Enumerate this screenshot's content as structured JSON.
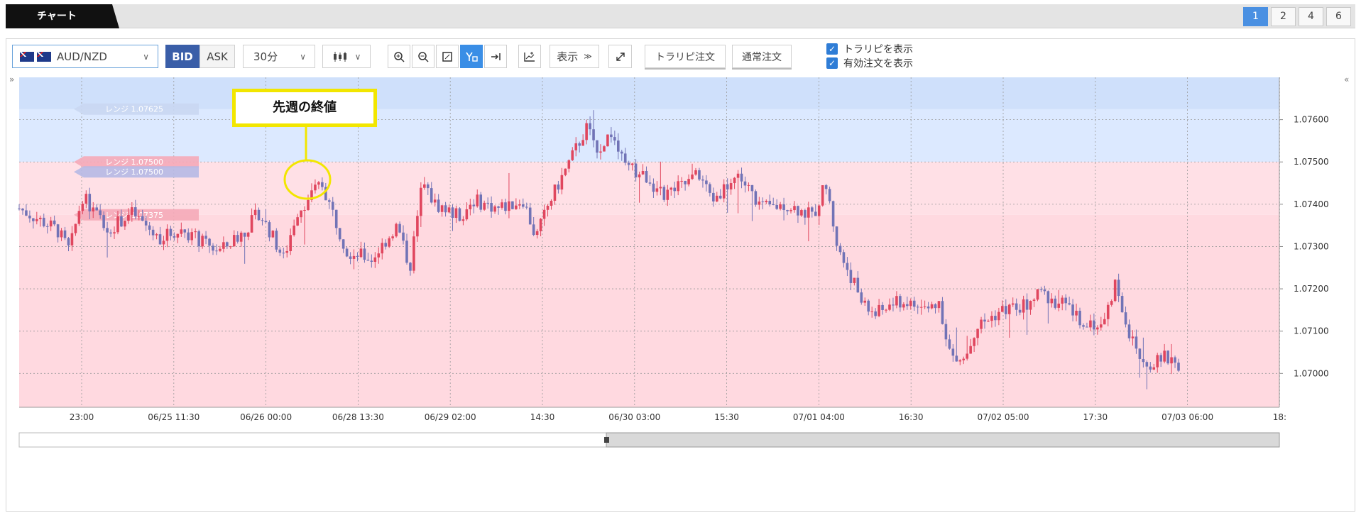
{
  "header": {
    "title": "チャート",
    "layouts": [
      "1",
      "2",
      "4",
      "6"
    ],
    "active_layout": "1"
  },
  "toolbar": {
    "pair": "AUD/NZD",
    "bid_label": "BID",
    "ask_label": "ASK",
    "timeframe": "30分",
    "display_label": "表示",
    "trailpi_order_label": "トラリピ注文",
    "normal_order_label": "通常注文",
    "show_trailpi_label": "トラリピを表示",
    "show_orders_label": "有効注文を表示"
  },
  "colors": {
    "accent": "#3a8ee6",
    "up_candle": "#e0465e",
    "down_candle": "#7173b6",
    "range_sell_zone": "#dce9ff",
    "range_buy_zone": "#ffd9e0"
  },
  "annotation": {
    "text": "先週の終値"
  },
  "range_labels": [
    {
      "text": "レンジ 1.07625",
      "color": "#c9d7f2"
    },
    {
      "text": "レンジ 1.07500",
      "color": "#f5aab8"
    },
    {
      "text": "レンジ 1.07500",
      "color": "#b6b9e4"
    },
    {
      "text": "レンジ 1.07375",
      "color": "#f5aab8"
    }
  ],
  "chart_data": {
    "type": "candlestick",
    "y_ticks": [
      "1.07600",
      "1.07500",
      "1.07400",
      "1.07300",
      "1.07200",
      "1.07100",
      "1.07000"
    ],
    "x_ticks": [
      "23:00",
      "06/25 11:30",
      "06/26 00:00",
      "06/28 13:30",
      "06/29 02:00",
      "14:30",
      "06/30 03:00",
      "15:30",
      "07/01 04:00",
      "16:30",
      "07/02 05:00",
      "17:30",
      "07/03 06:00",
      "18:"
    ],
    "ylim": [
      1.0692,
      1.077
    ],
    "grid": true,
    "close_path": [
      [
        0.0,
        1.0739
      ],
      [
        0.03,
        1.0734
      ],
      [
        0.04,
        1.0729
      ],
      [
        0.05,
        1.0742
      ],
      [
        0.07,
        1.0734
      ],
      [
        0.09,
        1.0738
      ],
      [
        0.11,
        1.0732
      ],
      [
        0.13,
        1.0734
      ],
      [
        0.15,
        1.073
      ],
      [
        0.16,
        1.0729
      ],
      [
        0.18,
        1.0734
      ],
      [
        0.19,
        1.0738
      ],
      [
        0.2,
        1.0733
      ],
      [
        0.21,
        1.0727
      ],
      [
        0.22,
        1.0738
      ],
      [
        0.24,
        1.0745
      ],
      [
        0.25,
        1.0737
      ],
      [
        0.26,
        1.0729
      ],
      [
        0.28,
        1.0727
      ],
      [
        0.3,
        1.0735
      ],
      [
        0.31,
        1.0725
      ],
      [
        0.32,
        1.0745
      ],
      [
        0.33,
        1.074
      ],
      [
        0.35,
        1.0737
      ],
      [
        0.36,
        1.0741
      ],
      [
        0.38,
        1.0739
      ],
      [
        0.4,
        1.0741
      ],
      [
        0.41,
        1.0732
      ],
      [
        0.42,
        1.074
      ],
      [
        0.43,
        1.0746
      ],
      [
        0.45,
        1.0758
      ],
      [
        0.46,
        1.0753
      ],
      [
        0.47,
        1.0757
      ],
      [
        0.48,
        1.0749
      ],
      [
        0.5,
        1.0746
      ],
      [
        0.51,
        1.0742
      ],
      [
        0.53,
        1.0745
      ],
      [
        0.54,
        1.0747
      ],
      [
        0.55,
        1.0741
      ],
      [
        0.57,
        1.0747
      ],
      [
        0.59,
        1.0739
      ],
      [
        0.61,
        1.074
      ],
      [
        0.63,
        1.0737
      ],
      [
        0.64,
        1.0745
      ],
      [
        0.65,
        1.0729
      ],
      [
        0.66,
        1.0723
      ],
      [
        0.67,
        1.0716
      ],
      [
        0.68,
        1.0714
      ],
      [
        0.69,
        1.0716
      ],
      [
        0.7,
        1.0717
      ],
      [
        0.72,
        1.0715
      ],
      [
        0.73,
        1.0717
      ],
      [
        0.74,
        1.0703
      ],
      [
        0.75,
        1.0703
      ],
      [
        0.76,
        1.0711
      ],
      [
        0.78,
        1.0715
      ],
      [
        0.8,
        1.0716
      ],
      [
        0.81,
        1.0719
      ],
      [
        0.83,
        1.0716
      ],
      [
        0.84,
        1.0713
      ],
      [
        0.85,
        1.0712
      ],
      [
        0.86,
        1.0711
      ],
      [
        0.87,
        1.0722
      ],
      [
        0.88,
        1.071
      ],
      [
        0.89,
        1.0703
      ],
      [
        0.9,
        1.0702
      ],
      [
        0.91,
        1.0704
      ],
      [
        0.92,
        1.0702
      ]
    ]
  }
}
